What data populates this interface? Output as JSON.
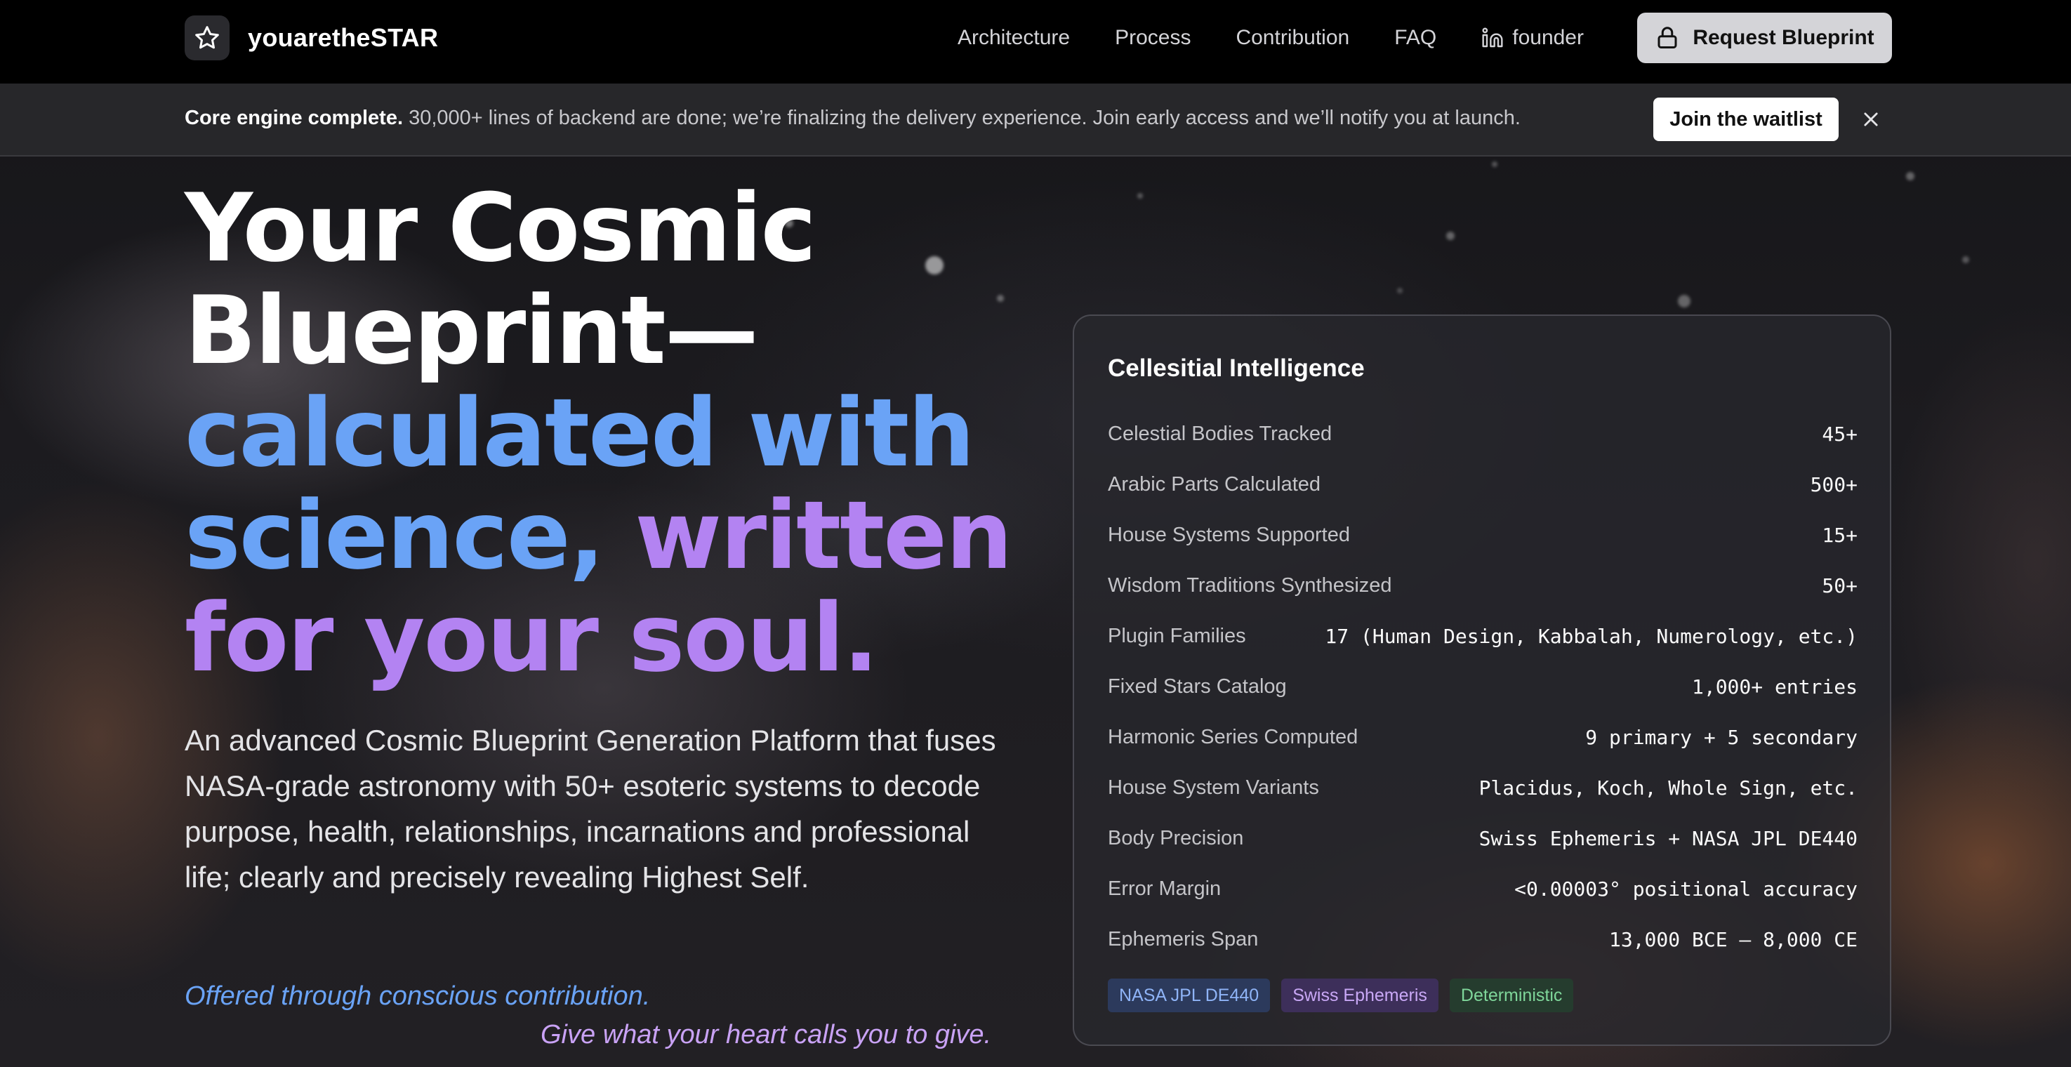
{
  "nav": {
    "brand": "youaretheSTAR",
    "links": [
      "Architecture",
      "Process",
      "Contribution",
      "FAQ"
    ],
    "founder_label": "founder",
    "cta_label": "Request Blueprint"
  },
  "banner": {
    "bold": "Core engine complete.",
    "text": " 30,000+ lines of backend are done; we’re finalizing the delivery experience. Join early access and we’ll notify you at launch.",
    "button_label": "Join the waitlist"
  },
  "hero": {
    "title_line1": "Your Cosmic",
    "title_line2": "Blueprint—",
    "title_line3": "calculated with",
    "title_line4a": "science, ",
    "title_line4b": "written",
    "title_line5": "for your soul.",
    "description": "An advanced Cosmic Blueprint Generation Platform that fuses NASA-grade astronomy with 50+ esoteric systems to decode purpose, health, relationships, incarnations and professional life; clearly and precisely revealing Highest Self.",
    "offer_line": "Offered through conscious contribution.",
    "give_line": "Give what your heart calls you to give."
  },
  "card": {
    "title": "Cellesitial Intelligence",
    "stats": [
      {
        "label": "Celestial Bodies Tracked",
        "value": "45+"
      },
      {
        "label": "Arabic Parts Calculated",
        "value": "500+"
      },
      {
        "label": "House Systems Supported",
        "value": "15+"
      },
      {
        "label": "Wisdom Traditions Synthesized",
        "value": "50+"
      },
      {
        "label": "Plugin Families",
        "value": "17 (Human Design, Kabbalah, Numerology, etc.)"
      },
      {
        "label": "Fixed Stars Catalog",
        "value": "1,000+ entries"
      },
      {
        "label": "Harmonic Series Computed",
        "value": "9 primary + 5 secondary"
      },
      {
        "label": "House System Variants",
        "value": "Placidus, Koch, Whole Sign, etc."
      },
      {
        "label": "Body Precision",
        "value": "Swiss Ephemeris + NASA JPL DE440"
      },
      {
        "label": "Error Margin",
        "value": "<0.00003° positional accuracy"
      },
      {
        "label": "Ephemeris Span",
        "value": "13,000 BCE – 8,000 CE"
      }
    ],
    "tags": [
      {
        "label": "NASA JPL DE440",
        "bg": "#2c3a5c",
        "fg": "#8fb4f7"
      },
      {
        "label": "Swiss Ephemeris",
        "bg": "#3d2f5a",
        "fg": "#c9a8f6"
      },
      {
        "label": "Deterministic",
        "bg": "#253c2e",
        "fg": "#7fd69a"
      }
    ]
  },
  "colors": {
    "accent_blue": "#6aa3f6",
    "accent_purple": "#b383f2",
    "cta_bg": "#d4d4d8"
  }
}
